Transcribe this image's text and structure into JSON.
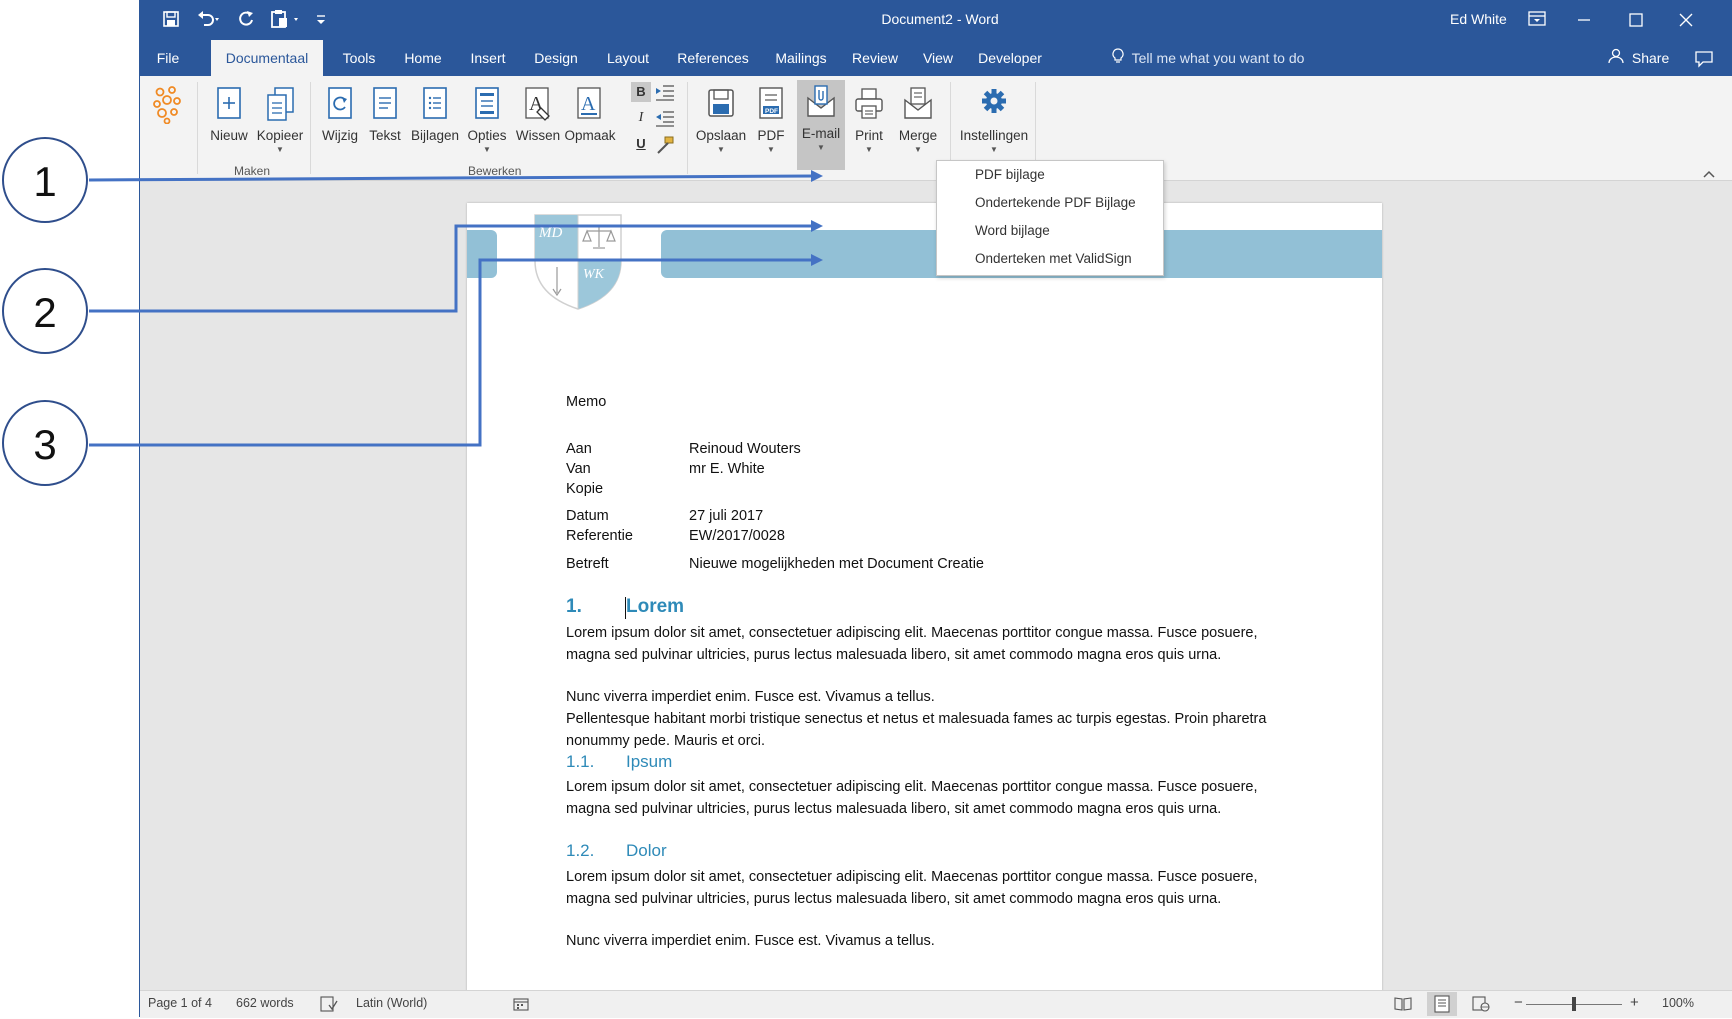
{
  "window": {
    "title": "Document2  -  Word",
    "user": "Ed White"
  },
  "tabs": [
    {
      "label": "File",
      "active": false
    },
    {
      "label": "Documentaal",
      "active": true
    },
    {
      "label": "Tools",
      "active": false
    },
    {
      "label": "Home",
      "active": false
    },
    {
      "label": "Insert",
      "active": false
    },
    {
      "label": "Design",
      "active": false
    },
    {
      "label": "Layout",
      "active": false
    },
    {
      "label": "References",
      "active": false
    },
    {
      "label": "Mailings",
      "active": false
    },
    {
      "label": "Review",
      "active": false
    },
    {
      "label": "View",
      "active": false
    },
    {
      "label": "Developer",
      "active": false
    }
  ],
  "tell_me": "Tell me what you want to do",
  "share_label": "Share",
  "ribbon": {
    "buttons": {
      "nieuw": "Nieuw",
      "kopieer": "Kopieer",
      "wijzig": "Wijzig",
      "tekst": "Tekst",
      "bijlagen": "Bijlagen",
      "opties": "Opties",
      "wissen": "Wissen",
      "opmaak": "Opmaak",
      "opslaan": "Opslaan",
      "pdf": "PDF",
      "email": "E-mail",
      "print": "Print",
      "merge": "Merge",
      "instellingen": "Instellingen"
    },
    "format": {
      "bold": "B",
      "italic": "I",
      "underline": "U"
    },
    "groups": {
      "maken": "Maken",
      "bewerken": "Bewerken"
    }
  },
  "email_menu": [
    "PDF bijlage",
    "Ondertekende PDF Bijlage",
    "Word bijlage",
    "Onderteken met ValidSign"
  ],
  "callouts": [
    "1",
    "2",
    "3"
  ],
  "logo": {
    "top_left": "MD",
    "bottom_right": "WK"
  },
  "document": {
    "title": "Memo",
    "fields": [
      {
        "label": "Aan",
        "value": "Reinoud Wouters"
      },
      {
        "label": "Van",
        "value": "mr E. White"
      },
      {
        "label": "Kopie",
        "value": ""
      },
      {
        "label": "Datum",
        "value": "27 juli 2017"
      },
      {
        "label": "Referentie",
        "value": "EW/2017/0028"
      },
      {
        "label": "Betreft",
        "value": "Nieuwe mogelijkheden met Document Creatie"
      }
    ],
    "h1_number": "1.",
    "h1_title": "Lorem",
    "p1": "Lorem ipsum dolor sit amet, consectetuer adipiscing elit. Maecenas porttitor congue massa. Fusce posuere, magna sed pulvinar ultricies, purus lectus malesuada libero, sit amet commodo magna eros quis urna.",
    "p2": "Nunc viverra imperdiet enim. Fusce est. Vivamus a tellus.",
    "p3": "Pellentesque habitant morbi tristique senectus et netus et malesuada fames ac turpis egestas. Proin pharetra nonummy pede. Mauris et orci.",
    "h2a_number": "1.1.",
    "h2a_title": "Ipsum",
    "p4": "Lorem ipsum dolor sit amet, consectetuer adipiscing elit. Maecenas porttitor congue massa. Fusce posuere, magna sed pulvinar ultricies, purus lectus malesuada libero, sit amet commodo magna eros quis urna.",
    "h2b_number": "1.2.",
    "h2b_title": "Dolor",
    "p5": "Lorem ipsum dolor sit amet, consectetuer adipiscing elit. Maecenas porttitor congue massa. Fusce posuere, magna sed pulvinar ultricies, purus lectus malesuada libero, sit amet commodo magna eros quis urna.",
    "p6": "Nunc viverra imperdiet enim. Fusce est. Vivamus a tellus."
  },
  "status": {
    "page": "Page 1 of 4",
    "words": "662 words",
    "language": "Latin (World)",
    "zoom": "100%",
    "zoom_level": 1.0
  },
  "colors": {
    "title_bar": "#2b579a",
    "ribbon_bg": "#f3f3f3",
    "header_band": "#92c0d6",
    "heading_text": "#2e8ab8",
    "callout_line": "#4472c4"
  }
}
